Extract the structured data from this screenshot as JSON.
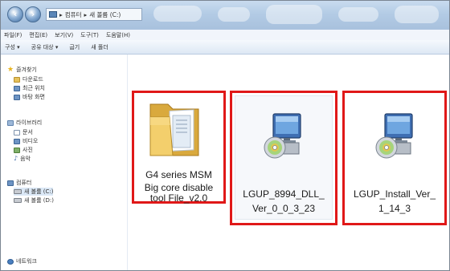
{
  "address": {
    "segments": [
      "컴퓨터",
      "새 볼륨 (C:)"
    ]
  },
  "menu": [
    "파일(F)",
    "편집(E)",
    "보기(V)",
    "도구(T)",
    "도움말(H)"
  ],
  "commands": [
    "구성 ▾",
    "공유 대상 ▾",
    "굽기",
    "새 폴더"
  ],
  "nav": {
    "favorites": "즐겨찾기",
    "downloads": "다운로드",
    "recent": "최근 위치",
    "desktop": "바탕 화면",
    "libraries": "라이브러리",
    "documents": "문서",
    "videos": "비디오",
    "pictures": "사진",
    "music": "음악",
    "computer": "컴퓨터",
    "drive_c": "새 볼륨 (C:)",
    "drive_d": "새 볼륨 (D:)",
    "network": "네트워크"
  },
  "files": [
    {
      "name_line1": "G4 series MSM",
      "name_line2": "Big core disable",
      "name_line3": "tool File_v2.0",
      "icon": "folder-icon"
    },
    {
      "name_line1": "LGUP_8994_DLL_",
      "name_line2": "Ver_0_0_3_23",
      "icon": "installer-icon"
    },
    {
      "name_line1": "LGUP_Install_Ver_",
      "name_line2": "1_14_3",
      "icon": "installer-icon"
    }
  ],
  "colors": {
    "highlight_border": "#e01818",
    "titlebar": "#b3cbe5"
  }
}
